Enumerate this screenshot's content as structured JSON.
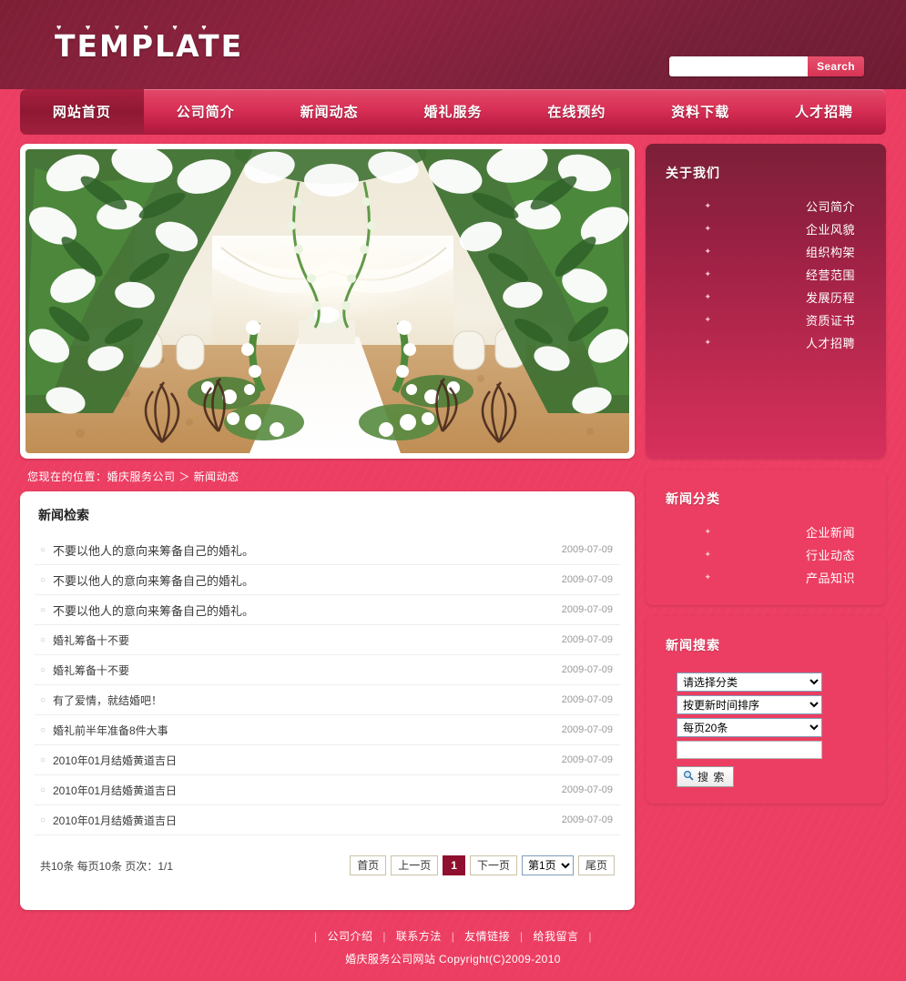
{
  "site": {
    "logo_text": "TEMPLATE",
    "hearts": "♥ ♥ ♥ ♥ ♥ ♥"
  },
  "search": {
    "value": "",
    "placeholder": "",
    "button_label": "Search"
  },
  "nav": {
    "items": [
      {
        "label": "网站首页",
        "active": true
      },
      {
        "label": "公司简介",
        "active": false
      },
      {
        "label": "新闻动态",
        "active": false
      },
      {
        "label": "婚礼服务",
        "active": false
      },
      {
        "label": "在线预约",
        "active": false
      },
      {
        "label": "资料下载",
        "active": false
      },
      {
        "label": "人才招聘",
        "active": false
      }
    ]
  },
  "hero": {
    "alt": "婚礼现场百合花拱门与白色地毯通道"
  },
  "breadcrumb": {
    "text": "您现在的位置：婚庆服务公司 ＞ 新闻动态"
  },
  "news": {
    "title": "新闻检索",
    "bullet": "○",
    "items": [
      {
        "title": "不要以他人的意向来筹备自己的婚礼。",
        "date": "2009-07-09",
        "size": "normal"
      },
      {
        "title": "不要以他人的意向来筹备自己的婚礼。",
        "date": "2009-07-09",
        "size": "normal"
      },
      {
        "title": "不要以他人的意向来筹备自己的婚礼。",
        "date": "2009-07-09",
        "size": "normal"
      },
      {
        "title": "婚礼筹备十不要",
        "date": "2009-07-09",
        "size": "small"
      },
      {
        "title": "婚礼筹备十不要",
        "date": "2009-07-09",
        "size": "small"
      },
      {
        "title": "有了爱情，就结婚吧！",
        "date": "2009-07-09",
        "size": "small"
      },
      {
        "title": "婚礼前半年准备8件大事",
        "date": "2009-07-09",
        "size": "small"
      },
      {
        "title": "2010年01月结婚黄道吉日",
        "date": "2009-07-09",
        "size": "small"
      },
      {
        "title": "2010年01月结婚黄道吉日",
        "date": "2009-07-09",
        "size": "small"
      },
      {
        "title": "2010年01月结婚黄道吉日",
        "date": "2009-07-09",
        "size": "small"
      }
    ]
  },
  "pagination": {
    "info": "共10条 每页10条 页次：1/1",
    "first_label": "首页",
    "prev_label": "上一页",
    "current_page": "1",
    "next_label": "下一页",
    "page_select_value": "第1页",
    "last_label": "尾页"
  },
  "about_panel": {
    "title": "关于我们",
    "arrow": "✦",
    "items": [
      {
        "label": "公司简介"
      },
      {
        "label": "企业风貌"
      },
      {
        "label": "组织构架"
      },
      {
        "label": "经营范围"
      },
      {
        "label": "发展历程"
      },
      {
        "label": "资质证书"
      },
      {
        "label": "人才招聘"
      }
    ]
  },
  "category_panel": {
    "title": "新闻分类",
    "arrow": "✦",
    "items": [
      {
        "label": "企业新闻"
      },
      {
        "label": "行业动态"
      },
      {
        "label": "产品知识"
      }
    ]
  },
  "news_search_panel": {
    "title": "新闻搜索",
    "category_value": "请选择分类",
    "sort_value": "按更新时间排序",
    "perpage_value": "每页20条",
    "keyword_value": "",
    "keyword_placeholder": "",
    "button_label": "搜 索",
    "button_icon": "search-icon"
  },
  "footer": {
    "links": [
      "公司介绍",
      "联系方法",
      "友情链接",
      "给我留言"
    ],
    "separator": "|",
    "copyright": "婚庆服务公司网站 Copyright(C)2009-2010"
  },
  "colors": {
    "body_pink": "#ec3e62",
    "header_maroon": "#8d2340",
    "nav_red": "#d82f55",
    "accent_dark": "#8f0f2e",
    "white": "#ffffff"
  }
}
